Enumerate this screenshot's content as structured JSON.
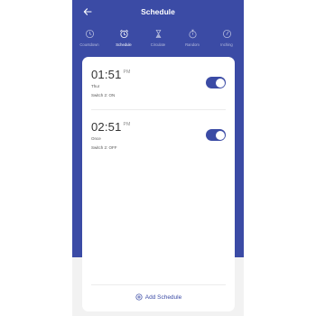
{
  "header": {
    "title": "Schedule"
  },
  "tabs": [
    {
      "label": "Countdown",
      "icon": "clock-icon",
      "active": false
    },
    {
      "label": "Schedule",
      "icon": "alarm-clock-icon",
      "active": true
    },
    {
      "label": "Circulate",
      "icon": "hourglass-icon",
      "active": false
    },
    {
      "label": "Random",
      "icon": "timer-icon",
      "active": false
    },
    {
      "label": "Inching",
      "icon": "inching-icon",
      "active": false
    }
  ],
  "schedules": [
    {
      "time": "01:51",
      "ampm": "PM",
      "repeat": "Thur",
      "action": "Switch 2: ON",
      "enabled": true
    },
    {
      "time": "02:51",
      "ampm": "PM",
      "repeat": "Once",
      "action": "Switch 2: OFF",
      "enabled": true
    }
  ],
  "footer": {
    "add_label": "Add Schedule"
  },
  "colors": {
    "primary": "#3b4ba5",
    "background": "#f2f2f2"
  }
}
